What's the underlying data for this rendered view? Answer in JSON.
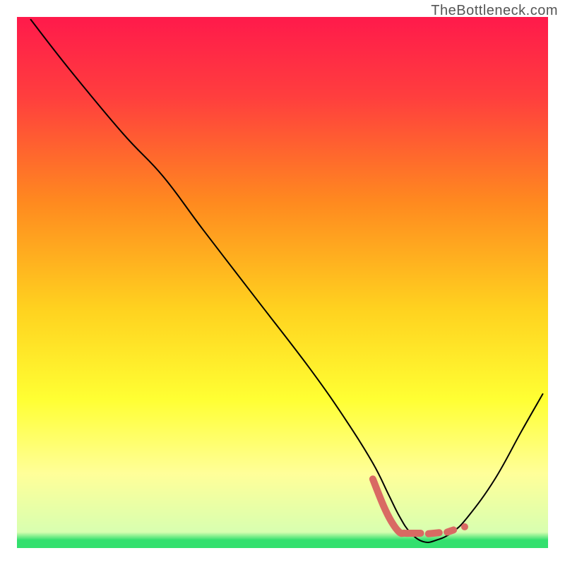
{
  "watermark": "TheBottleneck.com",
  "chart_data": {
    "type": "line",
    "title": "",
    "xlabel": "",
    "ylabel": "",
    "xlim": [
      0,
      100
    ],
    "ylim": [
      0,
      100
    ],
    "background_gradient_stops": [
      {
        "offset": 0,
        "color": "#ff1a4b"
      },
      {
        "offset": 0.15,
        "color": "#ff3e3e"
      },
      {
        "offset": 0.35,
        "color": "#ff8a1f"
      },
      {
        "offset": 0.55,
        "color": "#ffd21f"
      },
      {
        "offset": 0.72,
        "color": "#ffff33"
      },
      {
        "offset": 0.86,
        "color": "#ffff99"
      },
      {
        "offset": 0.97,
        "color": "#d8ffb0"
      },
      {
        "offset": 0.985,
        "color": "#33e06e"
      },
      {
        "offset": 1.0,
        "color": "#33e06e"
      }
    ],
    "series": [
      {
        "name": "bottleneck-curve",
        "type": "line",
        "stroke": "#000000",
        "stroke_width": 2,
        "x": [
          2.6,
          10,
          20,
          27.5,
          35,
          45,
          55,
          62,
          67,
          70,
          72,
          74,
          76.5,
          79,
          82,
          85,
          90,
          95,
          99
        ],
        "values": [
          99.5,
          90,
          78,
          70,
          60,
          47,
          34,
          24,
          16,
          10,
          6,
          3,
          1.2,
          1.5,
          3,
          6,
          13,
          22,
          29
        ]
      },
      {
        "name": "highlight-segment",
        "type": "line",
        "stroke": "#d96a63",
        "stroke_width": 10,
        "x": [
          67,
          69,
          70.5,
          72,
          73,
          74.5,
          76
        ],
        "values": [
          13,
          8,
          5,
          3,
          2.8,
          2.8,
          2.8
        ]
      },
      {
        "name": "dash-1",
        "type": "line",
        "stroke": "#d96a63",
        "stroke_width": 10,
        "x": [
          77.5,
          79.5
        ],
        "values": [
          2.7,
          2.9
        ]
      },
      {
        "name": "dash-2",
        "type": "line",
        "stroke": "#d96a63",
        "stroke_width": 10,
        "x": [
          81,
          82.2
        ],
        "values": [
          3.0,
          3.4
        ]
      },
      {
        "name": "dot-1",
        "type": "scatter",
        "stroke": "#d96a63",
        "stroke_width": 10,
        "x": [
          84.3
        ],
        "values": [
          4.0
        ]
      }
    ]
  }
}
